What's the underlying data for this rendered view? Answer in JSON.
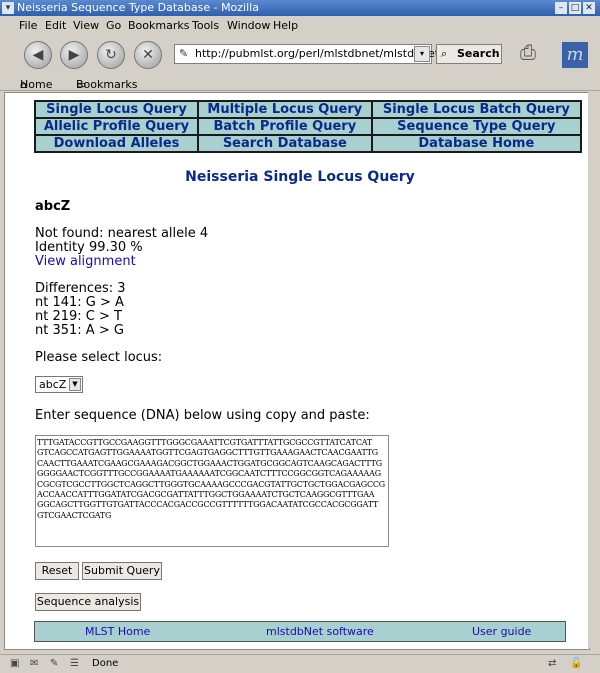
{
  "window": {
    "title": "Neisseria Sequence Type Database - Mozilla"
  },
  "menu": [
    "File",
    "Edit",
    "View",
    "Go",
    "Bookmarks",
    "Tools",
    "Window",
    "Help"
  ],
  "toolbar": {
    "url": "http://pubmlst.org/perl/mlstdbnet/mlstdbnet.pl?p",
    "search_label": "Search"
  },
  "bookmarks_bar": {
    "home": "Home",
    "bookmarks": "Bookmarks"
  },
  "nav": [
    [
      "Single Locus Query",
      "Multiple Locus Query",
      "Single Locus Batch Query"
    ],
    [
      "Allelic Profile Query",
      "Batch Profile Query",
      "Sequence Type Query"
    ],
    [
      "Download Alleles",
      "Search Database",
      "Database Home"
    ]
  ],
  "page": {
    "title": "Neisseria Single Locus Query",
    "locus_heading": "abcZ",
    "not_found": "Not found: nearest allele 4",
    "identity": "Identity 99.30 %",
    "view_alignment": "View alignment",
    "differences": "Differences: 3",
    "diff_1": "nt 141: G > A",
    "diff_2": "nt 219: C > T",
    "diff_3": "nt 351: A > G",
    "select_label": "Please select locus:",
    "selected_locus": "abcZ",
    "sequence_label": "Enter sequence (DNA) below using copy and paste:",
    "sequence": "TTTGATACCGTTGCCGAAGGTTTGGGCGAAATTCGTGATTTATTGCGCCGTTATCATCAT\nGTCAGCCATGAGTTGGAAAATGGTTCGAGTGAGGCTTTGTTGAAAGAACTCAACGAATTG\nCAACTTGAAATCGAAGCGAAAGACGGCTGGAAACTGGATGCGGCAGTCAAGCAGACTTTG\nGGGGAACTCGGTTTGCCGGAAAATGAAAAAATCGGCAATCTTTCCGGCGGTCAGAAAAAG\nCGCGTCGCCTTGGCTCAGGCTTGGGTGCAAAAGCCCGACGTATTGCTGCTGGACGAGCCG\nACCAACCATTTGGATATCGACGCGATTATTTGGCTGGAAAATCTGCTCAAGGCGTTTGAA\nGGCAGCTTGGTTGTGATTACCCACGACCGCCGTTTTTTGGACAATATCGCCACGCGGATT\nGTCGAACTCGATG",
    "reset_button": "Reset",
    "submit_button": "Submit Query",
    "sequence_analysis_button": "Sequence analysis"
  },
  "footer": {
    "mlst_home": "MLST Home",
    "software": "mlstdbNet software",
    "user_guide": "User guide"
  },
  "status": {
    "text": "Done"
  }
}
